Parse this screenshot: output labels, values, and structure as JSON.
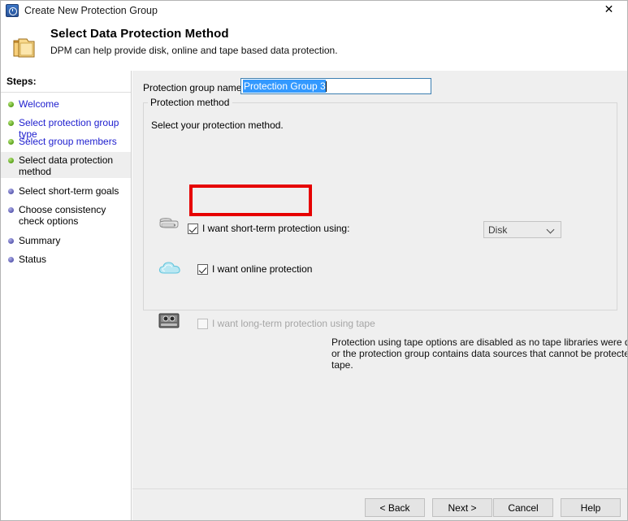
{
  "window": {
    "title": "Create New Protection Group",
    "icon": "dpm-clock-icon",
    "close_label": "✕"
  },
  "header": {
    "icon": "folder-icon",
    "title": "Select Data Protection Method",
    "subtitle": "DPM can help provide disk, online and tape based data protection."
  },
  "sidebar": {
    "label": "Steps:",
    "items": [
      {
        "label": "Welcome",
        "state": "done"
      },
      {
        "label": "Select protection group type",
        "state": "done"
      },
      {
        "label": "Select group members",
        "state": "done"
      },
      {
        "label": "Select data protection method",
        "state": "current"
      },
      {
        "label": "Select short-term goals",
        "state": "todo"
      },
      {
        "label": "Choose consistency check options",
        "state": "todo"
      },
      {
        "label": "Summary",
        "state": "todo"
      },
      {
        "label": "Status",
        "state": "todo"
      }
    ]
  },
  "main": {
    "pgname_label": "Protection group name:",
    "pgname_value": "Protection Group 3",
    "groupbox_legend": "Protection method",
    "groupbox_hint": "Select your protection method.",
    "options": {
      "short_term": {
        "icon": "disk-icon",
        "label": "I want short-term protection using:",
        "checked": true,
        "dropdown_value": "Disk",
        "dropdown_icon": "chevron-down-icon"
      },
      "online": {
        "icon": "cloud-icon",
        "label": "I want online protection",
        "checked": true,
        "highlighted": true
      },
      "long_term": {
        "icon": "tape-icon",
        "label": "I want long-term protection using tape",
        "checked": false,
        "disabled": true,
        "note": "Protection using tape options are disabled as no tape libraries were detected or the protection group contains data sources that cannot be protected on tape."
      }
    }
  },
  "footer": {
    "back": "< Back",
    "next": "Next >",
    "cancel": "Cancel",
    "help": "Help"
  },
  "colors": {
    "highlight_red": "#e60000",
    "selection_blue": "#3399ff",
    "link_blue": "#2020cf",
    "panel_gray": "#efefef"
  }
}
